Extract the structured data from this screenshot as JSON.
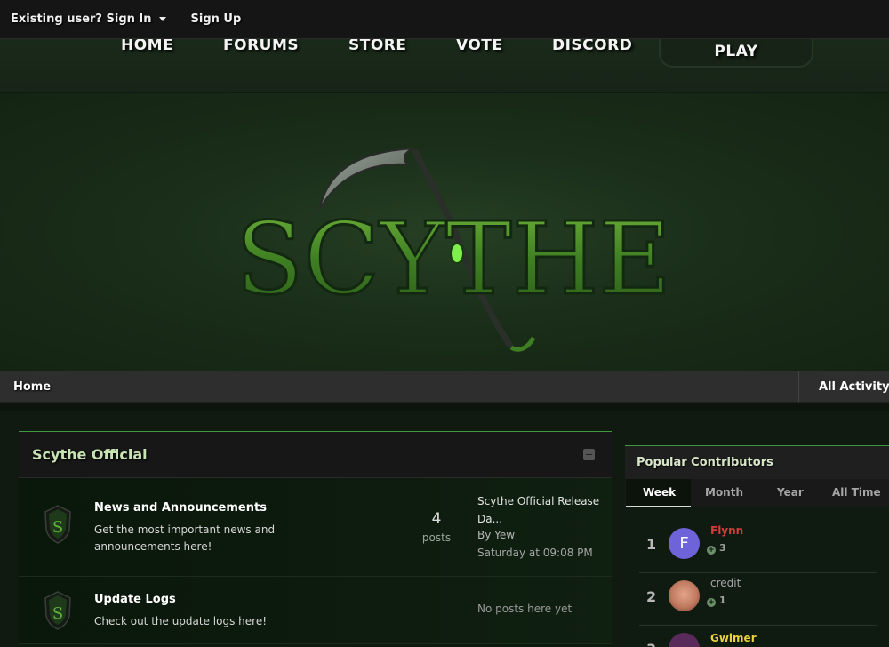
{
  "userbar": {
    "sign_in": "Existing user? Sign In",
    "sign_up": "Sign Up"
  },
  "nav": {
    "home": "HOME",
    "forums": "FORUMS",
    "store": "STORE",
    "vote": "VOTE",
    "discord": "DISCORD",
    "play": "PLAY"
  },
  "banner": {
    "logo_text": "SCYTHE"
  },
  "breadcrumb": {
    "home": "Home",
    "all_activity": "All Activity"
  },
  "forum_panel": {
    "title": "Scythe Official",
    "forums": [
      {
        "name": "News and Announcements",
        "description": "Get the most important news and announcements here!",
        "post_count": "4",
        "post_label": "posts",
        "last_title": "Scythe Official Release Da...",
        "last_by": "By Yew",
        "last_date": "Saturday at 09:08 PM"
      },
      {
        "name": "Update Logs",
        "description": "Check out the update logs here!",
        "empty_text": "No posts here yet"
      }
    ]
  },
  "contributors": {
    "title": "Popular Contributors",
    "tabs": [
      "Week",
      "Month",
      "Year",
      "All Time"
    ],
    "items": [
      {
        "rank": "1",
        "name": "Flynn",
        "rep": "3",
        "name_color": "#d23c3c",
        "avatar_letter": "F"
      },
      {
        "rank": "2",
        "name": "credit",
        "rep": "1",
        "name_color": "#a6a6a6"
      },
      {
        "rank": "3",
        "name": "Gwimer",
        "name_color": "#e8d43a"
      }
    ]
  },
  "colors": {
    "accent": "#3f9a3f",
    "logo_green": "#4f8f2a"
  }
}
